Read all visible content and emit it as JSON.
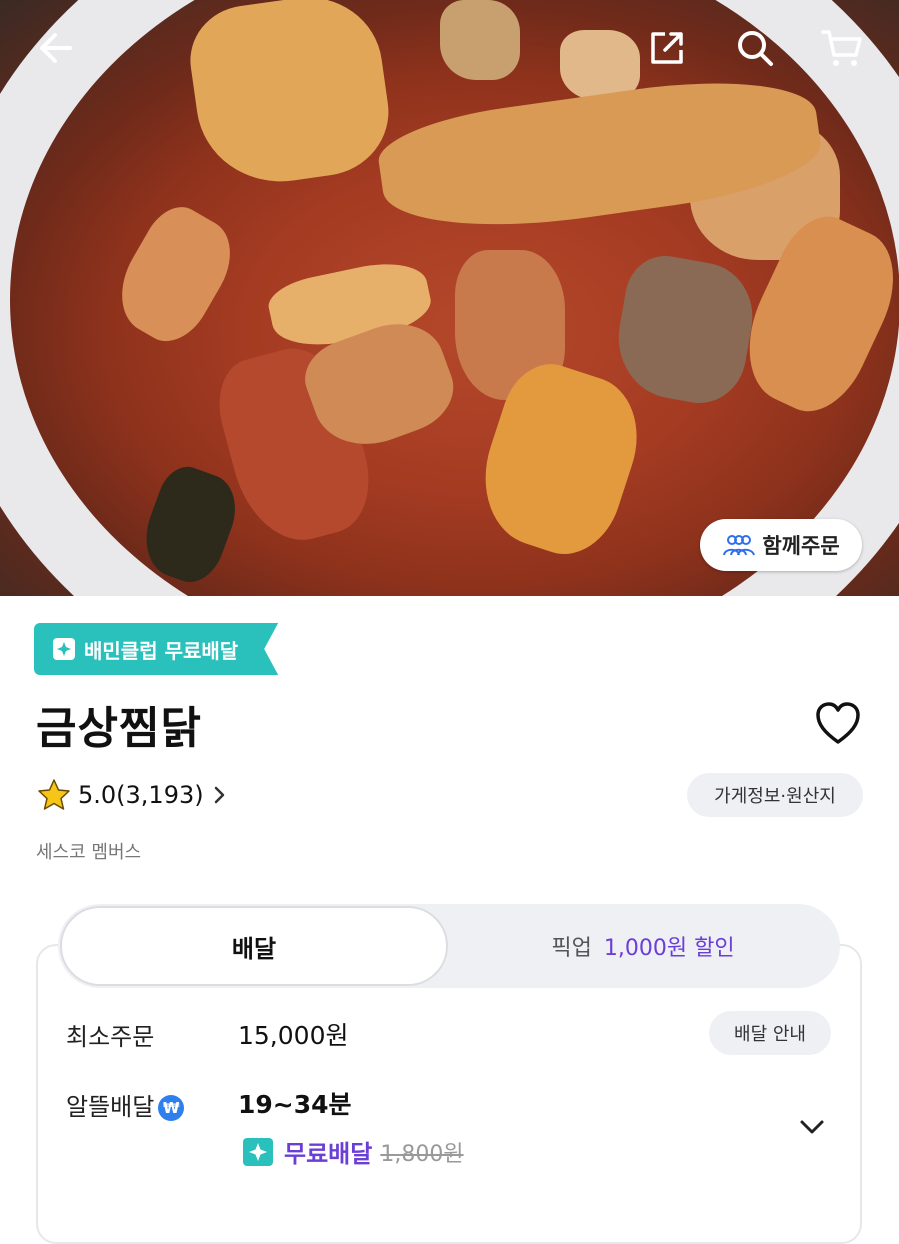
{
  "header": {
    "back_icon": "arrow-left-icon",
    "share_icon": "share-icon",
    "search_icon": "search-icon",
    "cart_icon": "cart-icon"
  },
  "hero": {
    "together_order_label": "함께주문",
    "together_icon": "people-icon"
  },
  "store": {
    "badge_label": "배민클럽 무료배달",
    "name": "금상찜닭",
    "rating": "5.0(3,193)",
    "info_button": "가게정보·원산지",
    "subtitle": "세스코 멤버스"
  },
  "delivery_tabs": {
    "active": "배달",
    "pickup": "픽업",
    "pickup_discount": "1,000원 할인"
  },
  "delivery_info": {
    "min_order_label": "최소주문",
    "min_order_value": "15,000원",
    "guide_button": "배달 안내",
    "saving_label": "알뜰배달",
    "saving_icon": "₩",
    "time": "19~34분",
    "free_label": "무료배달",
    "old_fee": "1,800원"
  },
  "colors": {
    "mint": "#2ac1bc",
    "purple": "#6b3fd6",
    "star": "#f5c518"
  }
}
